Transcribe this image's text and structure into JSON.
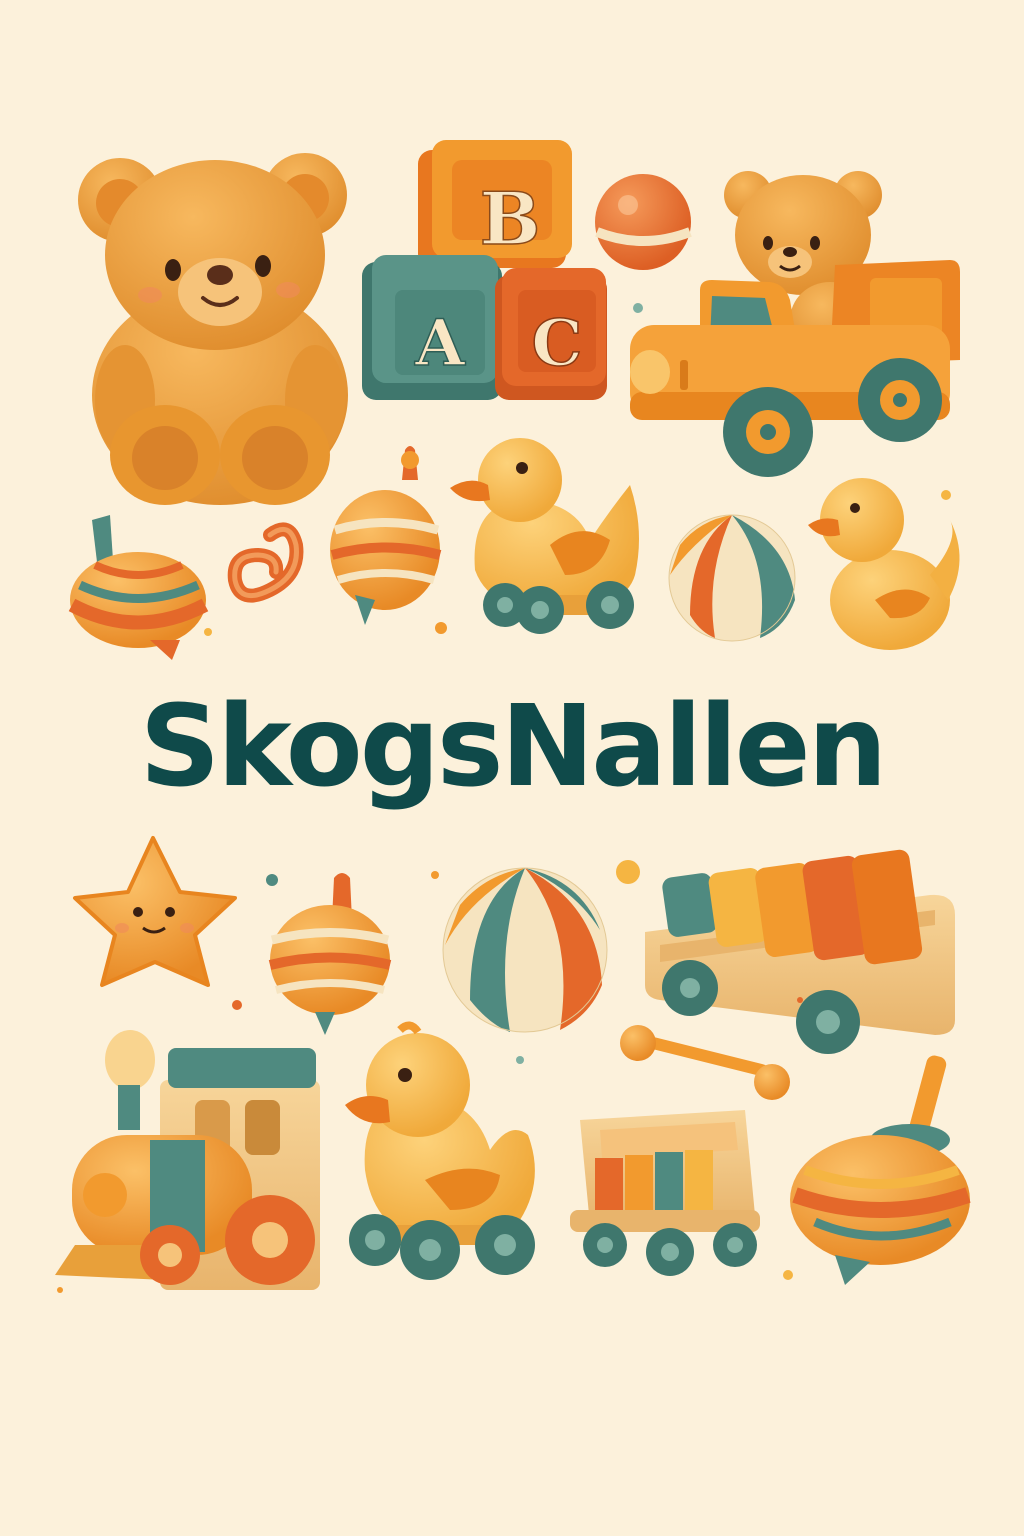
{
  "brand": {
    "name": "SkogsNallen"
  },
  "blocks": {
    "top": "B",
    "left": "A",
    "right": "C"
  },
  "colors": {
    "background": "#fcf1db",
    "brand_text": "#0f4a4a",
    "toy_orange": "#f29a2e",
    "toy_red_orange": "#e4682a",
    "toy_yellow": "#f6b545",
    "toy_teal": "#4f8a80",
    "toy_cream": "#f6e4c0",
    "wood": "#f0c27d"
  },
  "icons": [
    "teddy-bear-icon",
    "abc-blocks-icon",
    "ball-icon",
    "bear-in-truck-icon",
    "spinning-top-icon",
    "swirl-icon",
    "duck-on-wheels-icon",
    "beach-ball-icon",
    "rubber-duck-icon",
    "star-icon",
    "xylophone-cart-icon",
    "toy-train-icon",
    "mallet-icon",
    "toy-wagon-icon"
  ]
}
